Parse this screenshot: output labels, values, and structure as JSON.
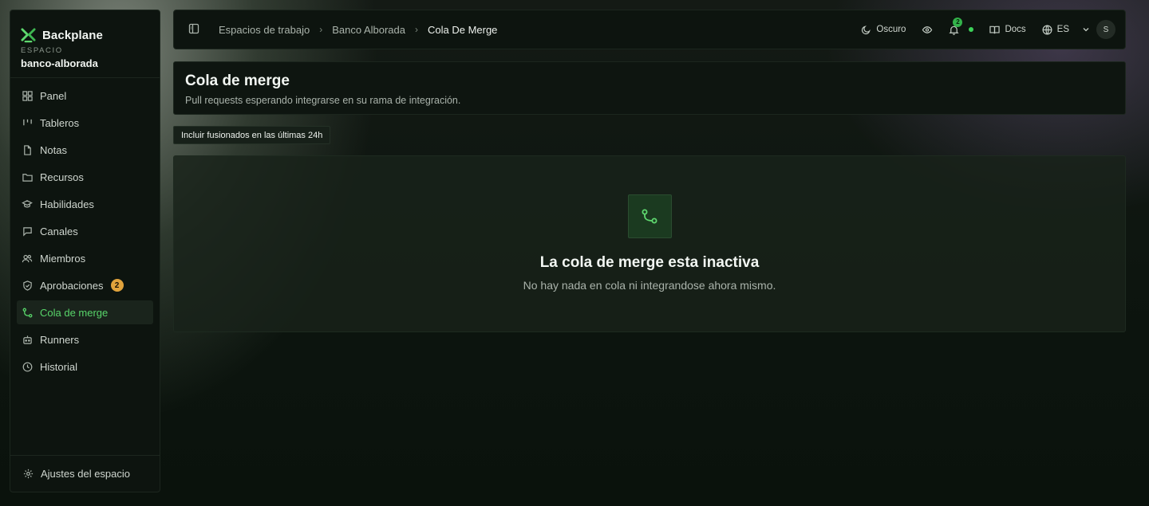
{
  "brand": {
    "name": "Backplane"
  },
  "space": {
    "caption": "ESPACIO",
    "name": "banco-alborada"
  },
  "nav": [
    {
      "label": "Panel",
      "icon": "grid-icon"
    },
    {
      "label": "Tableros",
      "icon": "kanban-icon"
    },
    {
      "label": "Notas",
      "icon": "file-icon"
    },
    {
      "label": "Recursos",
      "icon": "folder-icon"
    },
    {
      "label": "Habilidades",
      "icon": "graduation-cap-icon"
    },
    {
      "label": "Canales",
      "icon": "chat-icon"
    },
    {
      "label": "Miembros",
      "icon": "users-icon"
    },
    {
      "label": "Aprobaciones",
      "icon": "shield-icon",
      "badge": "2"
    },
    {
      "label": "Cola de merge",
      "icon": "git-merge-icon",
      "active": true
    },
    {
      "label": "Runners",
      "icon": "bot-icon"
    },
    {
      "label": "Historial",
      "icon": "clock-icon"
    }
  ],
  "footer": {
    "settings_label": "Ajustes del espacio"
  },
  "breadcrumbs": {
    "first": "Espacios de trabajo",
    "second": "Banco Alborada",
    "current": "Cola De Merge"
  },
  "topbar": {
    "theme_label": "Oscuro",
    "notifications_count": "2",
    "docs_label": "Docs",
    "language_label": "ES",
    "avatar_initial": "S"
  },
  "page": {
    "title": "Cola de merge",
    "subtitle": "Pull requests esperando integrarse en su rama de integración.",
    "filter_label": "Incluir fusionados en las últimas 24h"
  },
  "empty_state": {
    "title": "La cola de merge esta inactiva",
    "description": "No hay nada en cola ni integrandose ahora mismo."
  },
  "colors": {
    "accent": "#58d56a",
    "badge": "#e1a33c",
    "status": "#3cd259"
  }
}
